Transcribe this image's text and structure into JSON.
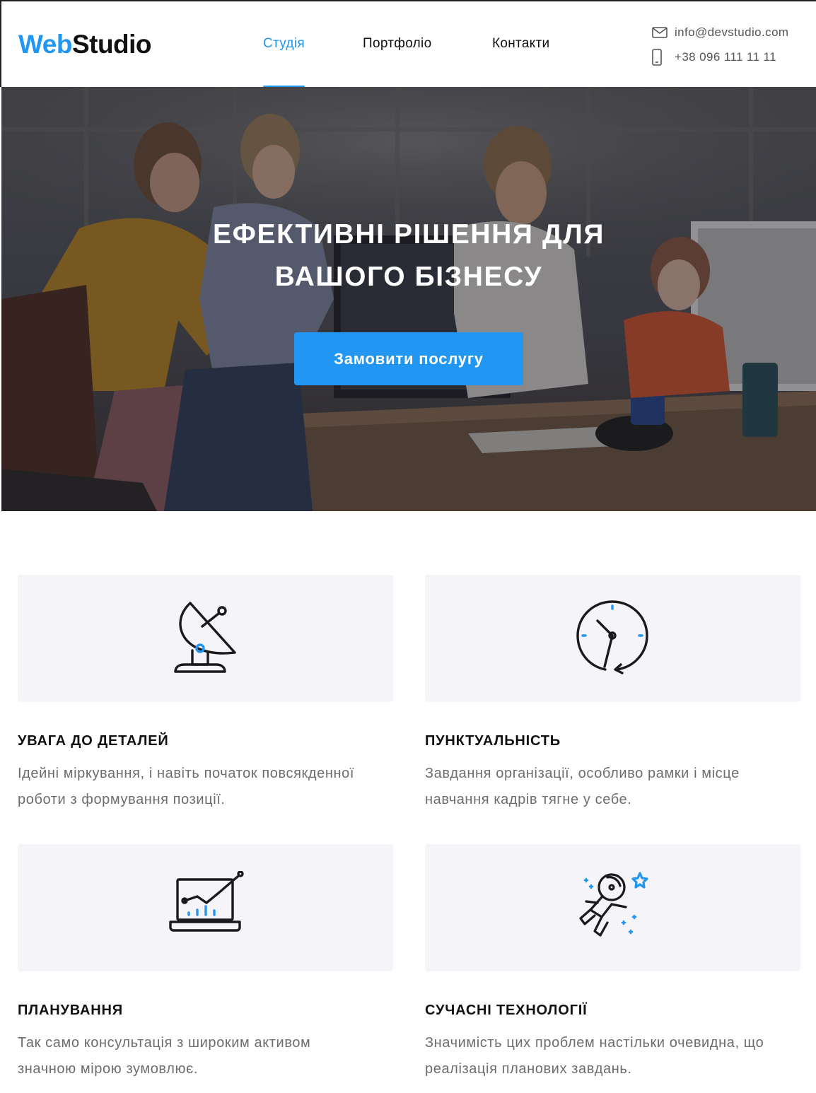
{
  "header": {
    "logo_part1": "Web",
    "logo_part2": "Studio",
    "nav": [
      {
        "label": "Студія",
        "active": true
      },
      {
        "label": "Портфоліо",
        "active": false
      },
      {
        "label": "Контакти",
        "active": false
      }
    ],
    "email": "info@devstudio.com",
    "phone": "+38 096 111 11 11",
    "email_icon": "mail-icon",
    "phone_icon": "phone-icon"
  },
  "hero": {
    "title_line1": "Ефективні рішення для",
    "title_line2": "вашого бізнесу",
    "button_label": "Замовити послугу"
  },
  "features": [
    {
      "icon": "satellite-dish-icon",
      "title": "Увага до деталей",
      "text_line1": "Ідейні міркування, і навіть початок повсякденної",
      "text_line2": "роботи з формування позиції."
    },
    {
      "icon": "clock-icon",
      "title": "Пунктуальність",
      "text_line1": "Завдання організації, особливо рамки і місце",
      "text_line2": "навчання кадрів тягне у себе."
    },
    {
      "icon": "laptop-chart-icon",
      "title": "Планування",
      "text_line1": "Так само консультація з широким активом",
      "text_line2": "значною мірою зумовлює."
    },
    {
      "icon": "astronaut-icon",
      "title": "Сучасні технології",
      "text_line1": "Значимість цих проблем настільки очевидна, що",
      "text_line2": "реалізація планових завдань."
    }
  ],
  "colors": {
    "accent": "#2196f3",
    "text": "#111111",
    "muted": "#6d6d6d",
    "card_bg": "#f4f4f9"
  }
}
